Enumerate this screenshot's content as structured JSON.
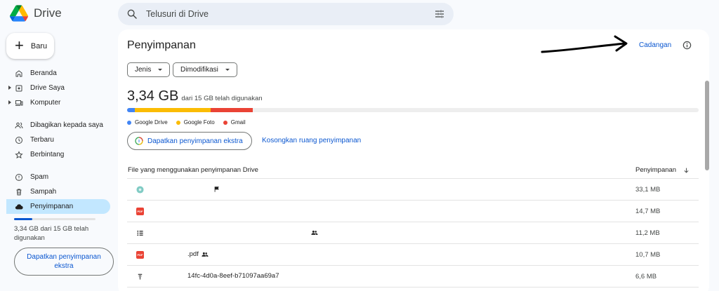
{
  "app": {
    "name": "Drive"
  },
  "search": {
    "placeholder": "Telusuri di Drive"
  },
  "sidebar": {
    "new_label": "Baru",
    "items": [
      {
        "label": "Beranda",
        "icon": "home-icon"
      },
      {
        "label": "Drive Saya",
        "icon": "my-drive-icon"
      },
      {
        "label": "Komputer",
        "icon": "computer-icon"
      },
      {
        "label": "Dibagikan kepada saya",
        "icon": "shared-icon"
      },
      {
        "label": "Terbaru",
        "icon": "clock-icon"
      },
      {
        "label": "Berbintang",
        "icon": "star-icon"
      },
      {
        "label": "Spam",
        "icon": "spam-icon"
      },
      {
        "label": "Sampah",
        "icon": "trash-icon"
      },
      {
        "label": "Penyimpanan",
        "icon": "cloud-icon"
      }
    ],
    "storage_fraction": 0.223,
    "storage_text": "3,34 GB dari 15 GB telah digunakan",
    "get_storage_label": "Dapatkan penyimpanan ekstra"
  },
  "main": {
    "title": "Penyimpanan",
    "backup_label": "Cadangan",
    "filters": {
      "type_label": "Jenis",
      "modified_label": "Dimodifikasi"
    },
    "used_amount": "3,34 GB",
    "used_suffix": "dari 15 GB telah digunakan",
    "segments": [
      {
        "name": "Google Drive",
        "color": "#4285f4",
        "fraction": 0.014
      },
      {
        "name": "Google Foto",
        "color": "#fbbc04",
        "fraction": 0.132
      },
      {
        "name": "Gmail",
        "color": "#ea4335",
        "fraction": 0.074
      }
    ],
    "get_extra_label": "Dapatkan penyimpanan ekstra",
    "empty_label": "Kosongkan ruang penyimpanan",
    "table": {
      "header_files": "File yang menggunakan penyimpanan Drive",
      "header_storage": "Penyimpanan",
      "rows": [
        {
          "name": "",
          "size": "33,1 MB",
          "icon": "photo-file-icon",
          "extra": "flag-icon"
        },
        {
          "name": "",
          "size": "14,7 MB",
          "icon": "pdf-file-icon",
          "extra": ""
        },
        {
          "name": "",
          "size": "11,2 MB",
          "icon": "list-file-icon",
          "extra": "shared-people-icon"
        },
        {
          "name": ".pdf",
          "size": "10,7 MB",
          "icon": "pdf-file-icon",
          "extra": "shared-people-icon"
        },
        {
          "name": "14fc-4d0a-8eef-b71097aa69a7",
          "size": "6,6 MB",
          "icon": "filter-file-icon",
          "extra": ""
        }
      ]
    }
  }
}
